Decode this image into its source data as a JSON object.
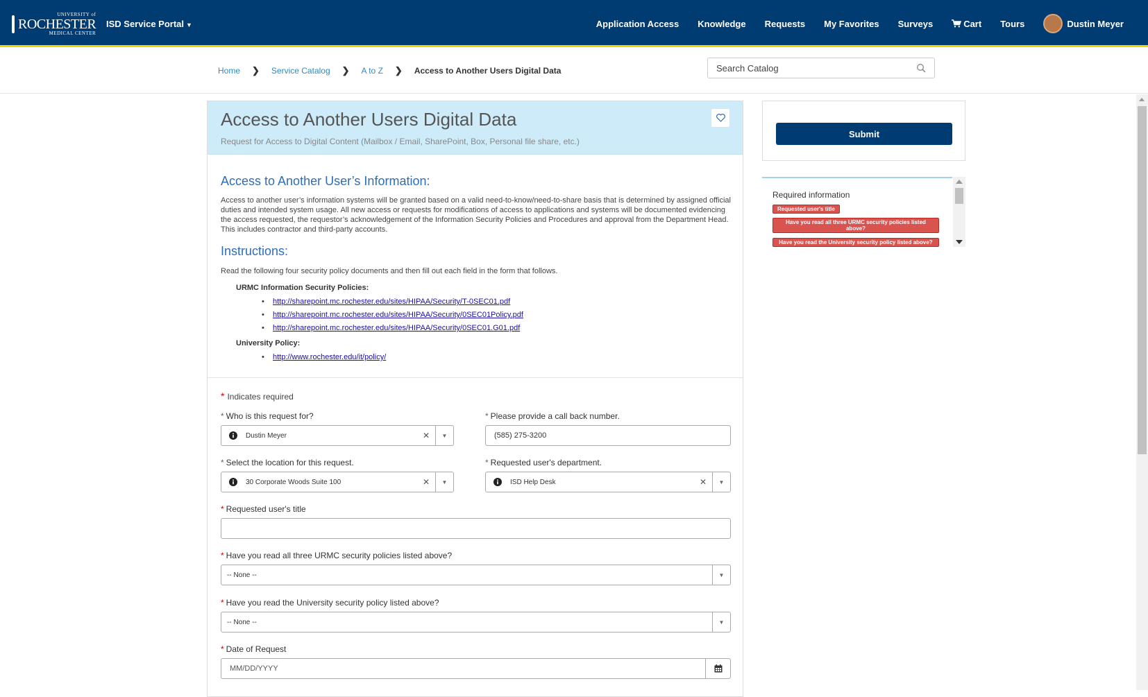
{
  "brand": {
    "logo_line1": "UNIVERSITY of",
    "logo_line2": "ROCHESTER",
    "logo_line3": "MEDICAL CENTER",
    "portal_label": "ISD Service Portal"
  },
  "nav": {
    "items": [
      "Application Access",
      "Knowledge",
      "Requests",
      "My Favorites",
      "Surveys"
    ],
    "cart": "Cart",
    "tours": "Tours",
    "user": "Dustin Meyer"
  },
  "breadcrumb": {
    "home": "Home",
    "catalog": "Service Catalog",
    "atoz": "A to Z",
    "current": "Access to Another Users Digital Data"
  },
  "search": {
    "placeholder": "Search Catalog"
  },
  "item": {
    "title": "Access to Another Users Digital Data",
    "subtitle": "Request for Access to Digital Content (Mailbox / Email, SharePoint, Box, Personal file share, etc.)",
    "heading_info": "Access to Another User’s Information:",
    "para_info": "Access to another user’s information systems will be granted based on a valid need-to-know/need-to-share basis that is determined by assigned official duties and intended system usage.  All new access or requests for modifications of access to applications and systems will be documented evidencing the access requested, the requestor’s acknowledgement of the Information Security Policies and Procedures and approval from the Department Head. This includes contractor and third-party accounts.",
    "heading_instr": "Instructions:",
    "para_instr": "Read the following four security policy documents and then fill out each field in the form that follows.",
    "urmc_label": "URMC Information Security Policies:",
    "urmc_links": [
      "http://sharepoint.mc.rochester.edu/sites/HIPAA/Security/T-0SEC01.pdf",
      "http://sharepoint.mc.rochester.edu/sites/HIPAA/Security/0SEC01Policy.pdf",
      "http://sharepoint.mc.rochester.edu/sites/HIPAA/Security/0SEC01.G01.pdf"
    ],
    "univ_label": "University Policy:",
    "univ_link": "http://www.rochester.edu/it/policy/"
  },
  "form": {
    "required_note": "Indicates required",
    "request_for_label": "Who is this request for?",
    "request_for_value": "Dustin Meyer",
    "callback_label": "Please provide a call back number.",
    "callback_value": "(585) 275-3200",
    "location_label": "Select the location for this request.",
    "location_value": "30 Corporate Woods Suite 100",
    "department_label": "Requested user's department.",
    "department_value": "ISD Help Desk",
    "title_label": "Requested user's title",
    "title_value": "",
    "urmc_read_label": "Have you read all three URMC security policies listed above?",
    "urmc_read_value": "-- None --",
    "univ_read_label": "Have you read the University security policy listed above?",
    "univ_read_value": "-- None --",
    "date_label": "Date of Request",
    "date_placeholder": "MM/DD/YYYY"
  },
  "sidebar": {
    "submit": "Submit",
    "required_title": "Required information",
    "badges": [
      "Requested user's title",
      "Have you read all three URMC security policies listed above?",
      "Have you read the University security policy listed above?"
    ]
  },
  "colors": {
    "navbar": "#003B71",
    "accent_stripe": "#F2D400",
    "header_band": "#CDEBF9",
    "heading_blue": "#2f6db5",
    "required_badge": "#d9534f"
  }
}
